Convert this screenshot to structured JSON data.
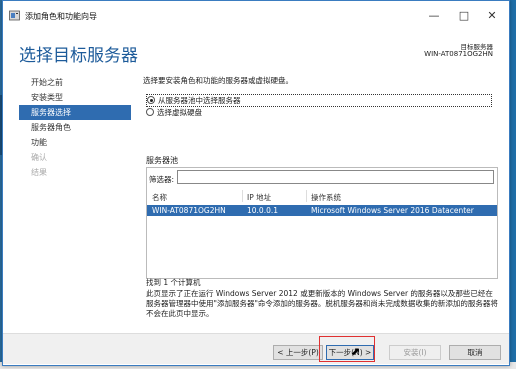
{
  "window": {
    "title": "添加角色和功能向导"
  },
  "header": {
    "page_title": "选择目标服务器",
    "target_label": "目标服务器",
    "target_server": "WIN-AT0871OG2HN"
  },
  "nav": {
    "items": [
      {
        "label": "开始之前",
        "state": "normal"
      },
      {
        "label": "安装类型",
        "state": "normal"
      },
      {
        "label": "服务器选择",
        "state": "active"
      },
      {
        "label": "服务器角色",
        "state": "normal"
      },
      {
        "label": "功能",
        "state": "normal"
      },
      {
        "label": "确认",
        "state": "disabled"
      },
      {
        "label": "结果",
        "state": "disabled"
      }
    ]
  },
  "content": {
    "intro": "选择要安装角色和功能的服务器或虚拟硬盘。",
    "option_pool": "从服务器池中选择服务器",
    "option_vhd": "选择虚拟硬盘",
    "pool_title": "服务器池",
    "filter_label": "筛选器:",
    "filter_value": "",
    "columns": {
      "name": "名称",
      "ip": "IP 地址",
      "os": "操作系统"
    },
    "rows": [
      {
        "name": "WIN-AT0871OG2HN",
        "ip": "10.0.0.1",
        "os": "Microsoft Windows Server 2016 Datacenter"
      }
    ],
    "found": "找到 1 个计算机",
    "description": "此页显示了正在运行 Windows Server 2012 或更新版本的 Windows Server 的服务器以及那些已经在服务器管理器中使用\"添加服务器\"命令添加的服务器。脱机服务器和尚未完成数据收集的新添加的服务器将不会在此页中显示。"
  },
  "footer": {
    "prev": "< 上一步(P)",
    "next": "下一步(N) >",
    "install": "安装(I)",
    "cancel": "取消"
  },
  "colors": {
    "accent": "#2f6cb0",
    "title_blue": "#1d5b9a"
  }
}
